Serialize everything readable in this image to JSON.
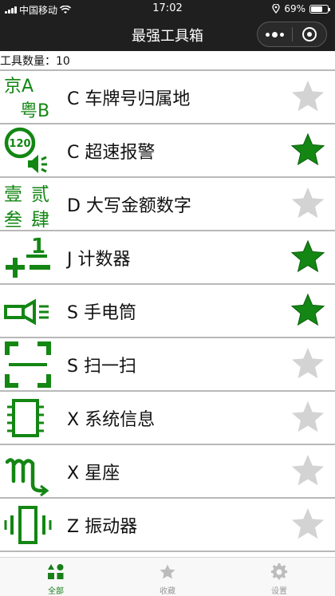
{
  "status_bar": {
    "carrier": "中国移动",
    "time": "17:02",
    "battery_text": "69%",
    "battery_level": 0.69
  },
  "nav": {
    "title": "最强工具箱"
  },
  "count": {
    "label": "工具数量：",
    "value": "10"
  },
  "colors": {
    "accent_green": "#138613",
    "star_gray": "#d3d3d3"
  },
  "tools": [
    {
      "label": "C 车牌号归属地",
      "icon": "license-plate-icon",
      "favorited": false,
      "icon_text": [
        "京A",
        "粤B"
      ]
    },
    {
      "label": "C 超速报警",
      "icon": "speed-alarm-icon",
      "favorited": true,
      "icon_text": [
        "120"
      ]
    },
    {
      "label": "D 大写金额数字",
      "icon": "chinese-numerals-icon",
      "favorited": false,
      "icon_text": [
        "壹",
        "贰",
        "叁",
        "肆"
      ]
    },
    {
      "label": "J 计数器",
      "icon": "counter-icon",
      "favorited": true,
      "icon_text": [
        "1"
      ]
    },
    {
      "label": "S 手电筒",
      "icon": "flashlight-icon",
      "favorited": true
    },
    {
      "label": "S 扫一扫",
      "icon": "scan-icon",
      "favorited": false
    },
    {
      "label": "X 系统信息",
      "icon": "chip-icon",
      "favorited": false
    },
    {
      "label": "X 星座",
      "icon": "scorpio-icon",
      "favorited": false
    },
    {
      "label": "Z 振动器",
      "icon": "vibration-icon",
      "favorited": false
    }
  ],
  "tabs": [
    {
      "label": "全部",
      "icon": "all-grid-icon",
      "active": true
    },
    {
      "label": "收藏",
      "icon": "star-icon",
      "active": false
    },
    {
      "label": "设置",
      "icon": "gear-icon",
      "active": false
    }
  ]
}
